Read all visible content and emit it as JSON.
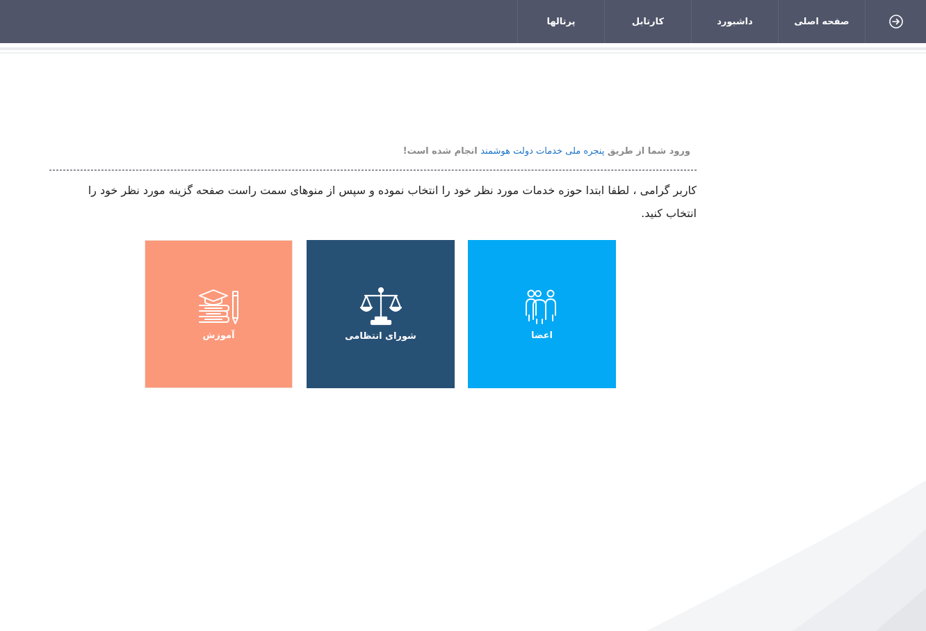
{
  "nav": {
    "items": [
      {
        "label": "صفحه اصلی"
      },
      {
        "label": "داشبورد"
      },
      {
        "label": "کارتابل"
      },
      {
        "label": "پرتالها"
      }
    ],
    "exit_icon": "exit-arrow-icon"
  },
  "login_note": {
    "prefix": "ورود شما از طریق ",
    "link": "پنجره ملی خدمات دولت هوشمند",
    "suffix": " انجام شده است!"
  },
  "instruction": "کاربر گرامی ، لطفا ابتدا حوزه خدمات مورد نظر خود را انتخاب نموده و سپس از منوهای سمت راست صفحه گزینه مورد نظر خود را انتخاب کنید.",
  "tiles": [
    {
      "label": "اعضا",
      "icon": "members-icon",
      "color": "#03a9f4"
    },
    {
      "label": "شورای انتظامی",
      "icon": "scales-icon",
      "color": "#275075"
    },
    {
      "label": "آموزش",
      "icon": "education-icon",
      "color": "#fb987a"
    }
  ],
  "colors": {
    "topbar": "#505569",
    "link": "#1a73c8"
  }
}
